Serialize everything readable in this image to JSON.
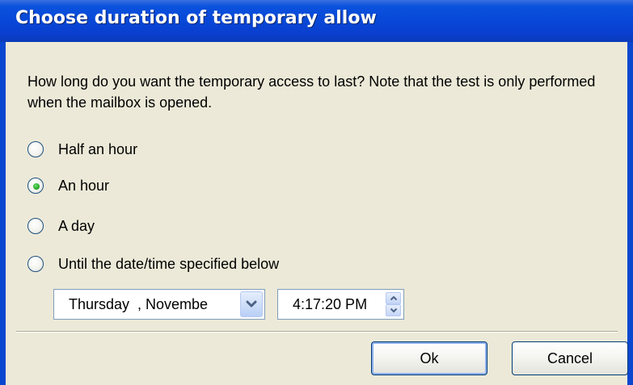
{
  "window": {
    "title": "Choose duration of temporary allow"
  },
  "description": "How long do you want the temporary access to last? Note that the test is only performed when the mailbox is opened.",
  "options": [
    {
      "label": "Half an hour",
      "selected": false
    },
    {
      "label": "An hour",
      "selected": true
    },
    {
      "label": "A day",
      "selected": false
    },
    {
      "label": "Until the date/time specified below",
      "selected": false
    }
  ],
  "date_picker": {
    "value": "Thursday  , Novembe",
    "icon": "chevron-down-icon"
  },
  "time_picker": {
    "value": "4:17:20 PM",
    "icons": [
      "spin-up-icon",
      "spin-down-icon"
    ]
  },
  "buttons": {
    "ok": "Ok",
    "cancel": "Cancel"
  },
  "colors": {
    "titlebar": "#0846d6",
    "dialog_bg": "#ece9d8",
    "radio_selected": "#21a121"
  }
}
